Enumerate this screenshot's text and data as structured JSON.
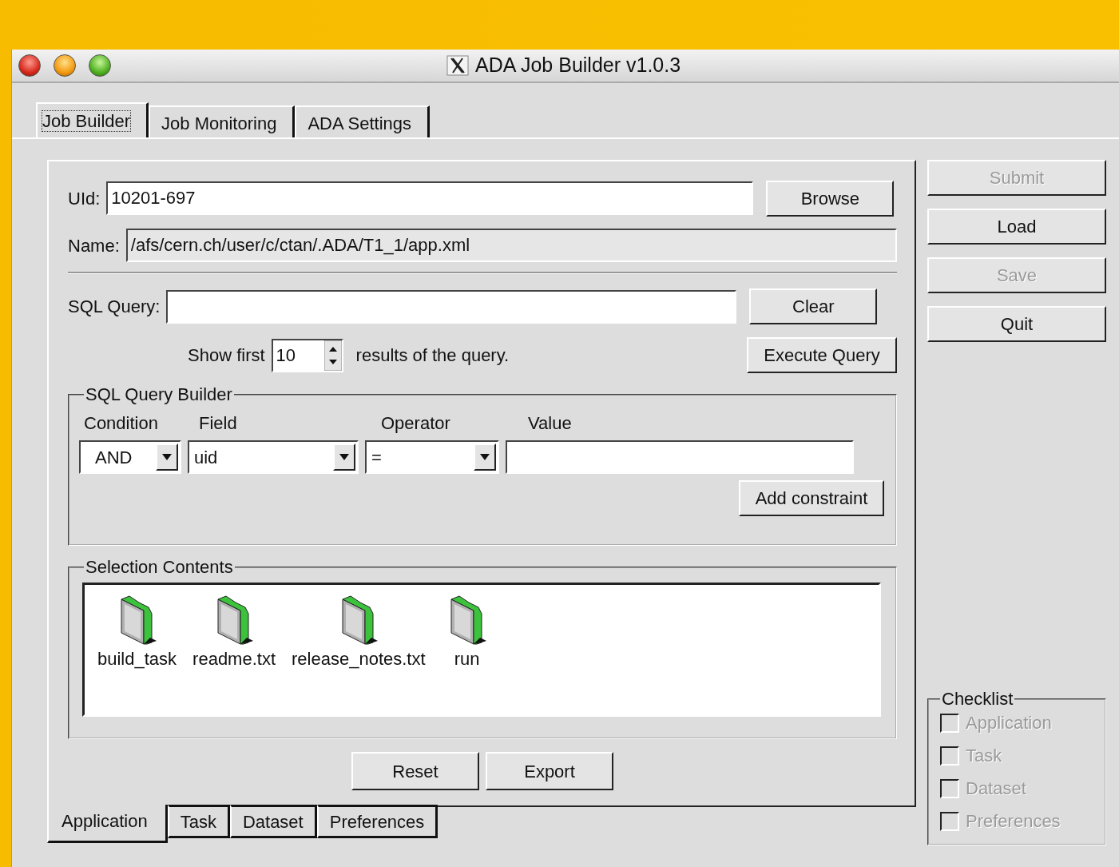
{
  "window": {
    "title": "ADA Job Builder v1.0.3"
  },
  "top_tabs": [
    {
      "label": "Job Builder",
      "selected": true
    },
    {
      "label": "Job Monitoring",
      "selected": false
    },
    {
      "label": "ADA Settings",
      "selected": false
    }
  ],
  "uid": {
    "label": "UId:",
    "value": "10201-697",
    "button": "Browse"
  },
  "name": {
    "label": "Name:",
    "value": "/afs/cern.ch/user/c/ctan/.ADA/T1_1/app.xml"
  },
  "sql_query": {
    "label": "SQL Query:",
    "button": "Clear"
  },
  "show_first": {
    "label": "Show first",
    "value": "10",
    "suffix": "results of the query.",
    "button": "Execute Query"
  },
  "query_builder": {
    "title": "SQL Query Builder",
    "columns": [
      "Condition",
      "Field",
      "Operator",
      "Value"
    ],
    "condition": "AND",
    "field": "uid",
    "operator": "=",
    "button": "Add constraint"
  },
  "selection_contents": {
    "title": "Selection Contents",
    "items": [
      {
        "name": "build_task"
      },
      {
        "name": "readme.txt"
      },
      {
        "name": "release_notes.txt"
      },
      {
        "name": "run"
      }
    ]
  },
  "panel_buttons": [
    "Reset",
    "Export"
  ],
  "bottom_tabs": [
    {
      "label": "Application",
      "selected": true
    },
    {
      "label": "Task",
      "selected": false
    },
    {
      "label": "Dataset",
      "selected": false
    },
    {
      "label": "Preferences",
      "selected": false
    }
  ],
  "side_buttons": [
    {
      "label": "Submit",
      "disabled": true
    },
    {
      "label": "Load",
      "disabled": false
    },
    {
      "label": "Save",
      "disabled": true
    },
    {
      "label": "Quit",
      "disabled": false
    }
  ],
  "checklist": {
    "title": "Checklist",
    "items": [
      {
        "label": "Application",
        "checked": false,
        "disabled": true
      },
      {
        "label": "Task",
        "checked": false,
        "disabled": true
      },
      {
        "label": "Dataset",
        "checked": false,
        "disabled": true
      },
      {
        "label": "Preferences",
        "checked": false,
        "disabled": true
      }
    ]
  }
}
